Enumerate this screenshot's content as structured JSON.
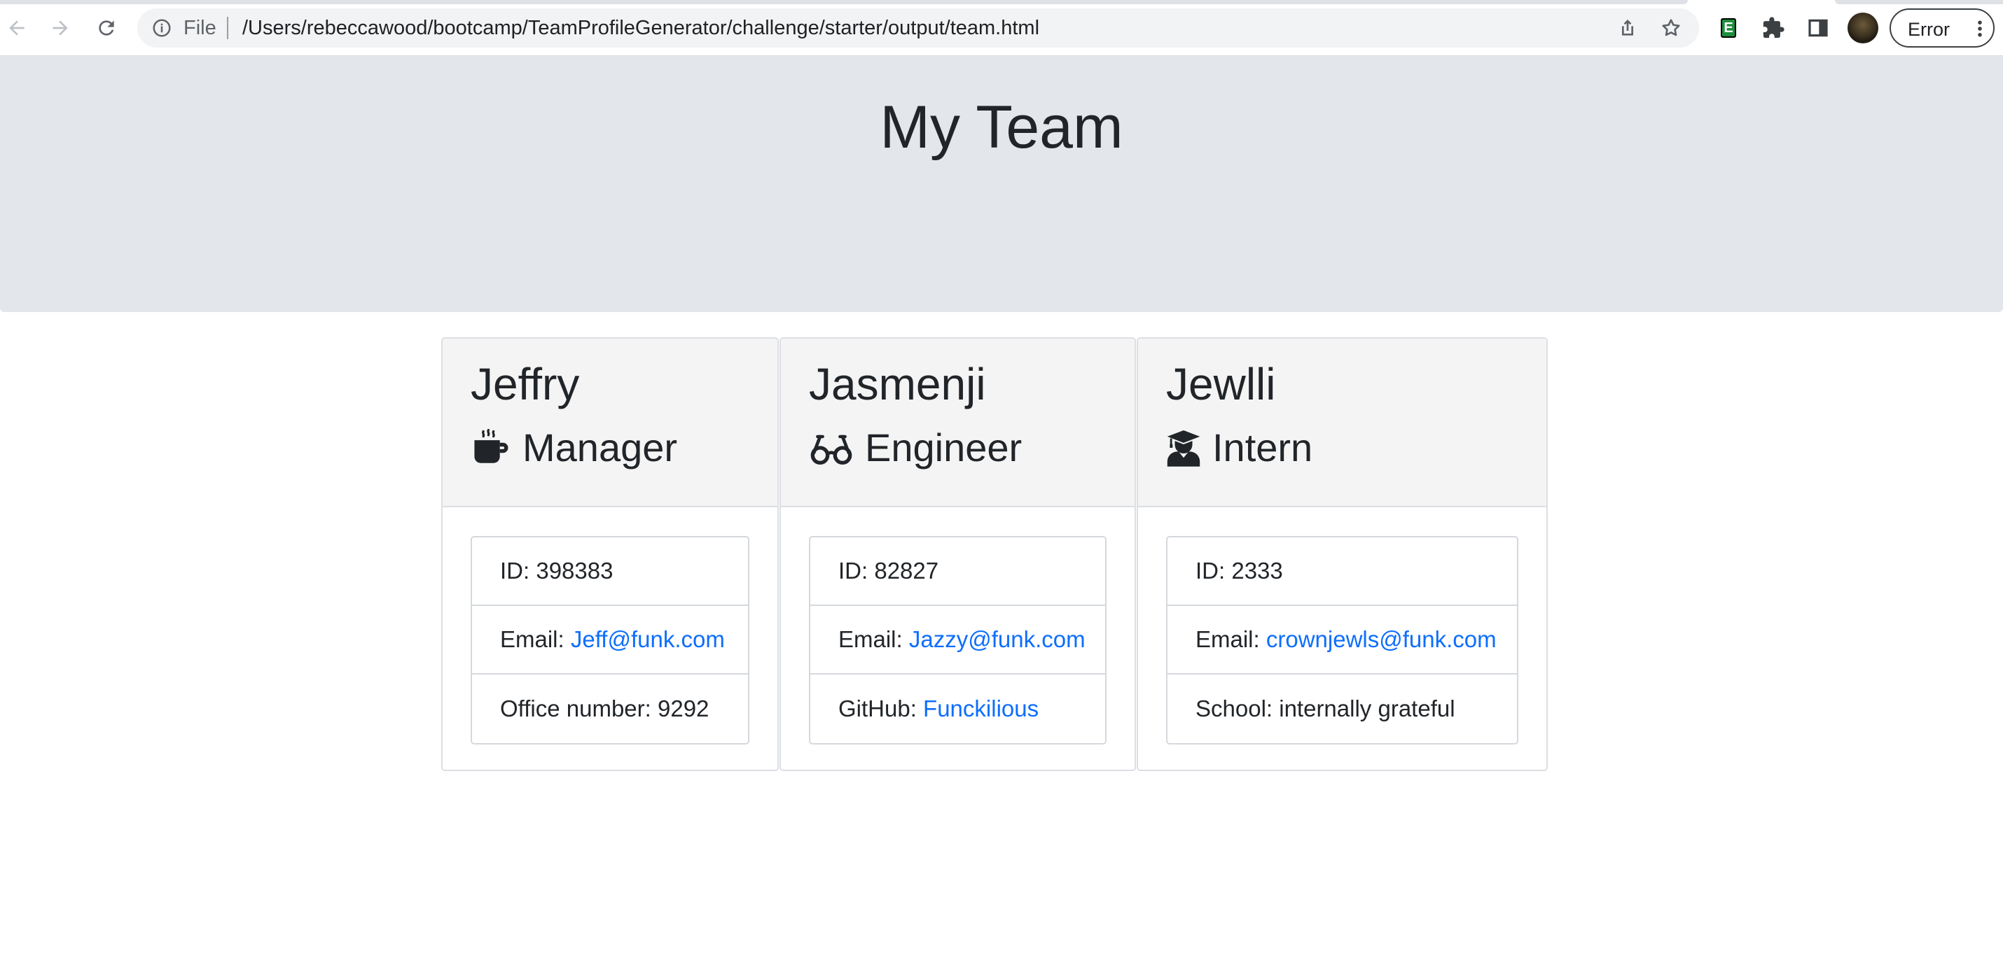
{
  "browser": {
    "omnibox_scheme": "File",
    "url": "/Users/rebeccawood/bootcamp/TeamProfileGenerator/challenge/starter/output/team.html",
    "error_label": "Error",
    "icons": [
      "back-icon",
      "forward-icon",
      "reload-icon",
      "info-icon",
      "share-icon",
      "bookmark-star-icon",
      "extension-e-icon",
      "puzzle-icon",
      "side-panel-icon",
      "avatar",
      "kebab-menu-icon"
    ]
  },
  "page": {
    "title": "My Team"
  },
  "team": [
    {
      "name": "Jeffry",
      "role": "Manager",
      "icon": "mug-hot-icon",
      "id": "ID: 398383",
      "email_label": "Email: ",
      "email": "Jeff@funk.com",
      "extra_label": "Office number: 9292",
      "extra_link": ""
    },
    {
      "name": "Jasmenji",
      "role": "Engineer",
      "icon": "glasses-icon",
      "id": "ID: 82827",
      "email_label": "Email: ",
      "email": "Jazzy@funk.com",
      "extra_label": "GitHub: ",
      "extra_link": "Funckilious"
    },
    {
      "name": "Jewlli",
      "role": "Intern",
      "icon": "graduate-icon",
      "id": "ID: 2333",
      "email_label": "Email: ",
      "email": "crownjewls@funk.com",
      "extra_label": "School: internally grateful",
      "extra_link": ""
    }
  ],
  "colors": {
    "link": "#0d6efd",
    "jumbotron": "#e3e6ea",
    "card_header": "#f4f4f4"
  }
}
